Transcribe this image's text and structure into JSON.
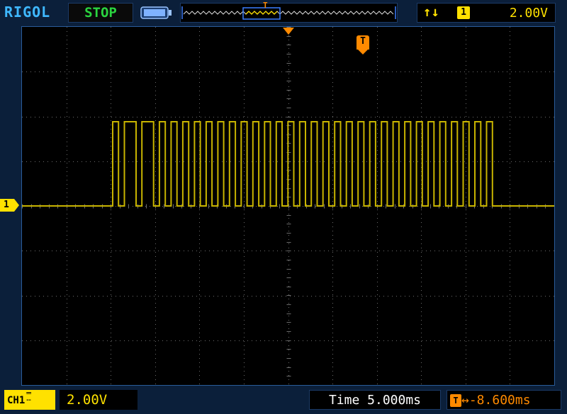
{
  "brand": "RIGOL",
  "run_state": "STOP",
  "trigger": {
    "edge_symbol": "↑↓",
    "source_channel": "1",
    "level": "2.00V",
    "marker_label": "T",
    "memory_marker": "T"
  },
  "channel": {
    "badge": "CH1",
    "marker": "1",
    "scale": "2.00V"
  },
  "timebase": {
    "label": "Time",
    "value": "5.000ms",
    "display": "Time 5.000ms"
  },
  "trigger_offset": {
    "icon": "T",
    "arrow": "↔",
    "value": "-8.600ms"
  },
  "colors": {
    "background": "#0b1f3a",
    "screen": "#000000",
    "trace": "#c8b400",
    "grid": "#6b6b6b",
    "brand": "#3fb8ff",
    "run_state": "#2ad43f",
    "trigger": "#ff8a00",
    "channel": "#ffe100"
  },
  "waveform": {
    "type": "digital pulse train",
    "description_levels": [
      "low",
      "high"
    ],
    "bits": [
      1,
      0,
      1,
      1,
      0,
      1,
      1,
      0,
      1,
      0,
      1,
      0,
      1,
      0,
      1,
      0,
      1,
      0,
      1,
      0,
      1,
      0,
      1,
      0,
      1,
      0,
      1,
      0,
      1,
      0,
      1,
      0,
      1,
      0,
      1,
      0,
      1,
      0,
      1,
      0,
      1,
      0,
      1,
      0,
      1,
      0,
      1,
      0,
      1,
      0,
      1,
      0,
      1,
      0,
      1,
      0,
      1,
      0,
      1,
      0,
      1,
      0,
      1,
      0,
      1,
      0
    ]
  }
}
